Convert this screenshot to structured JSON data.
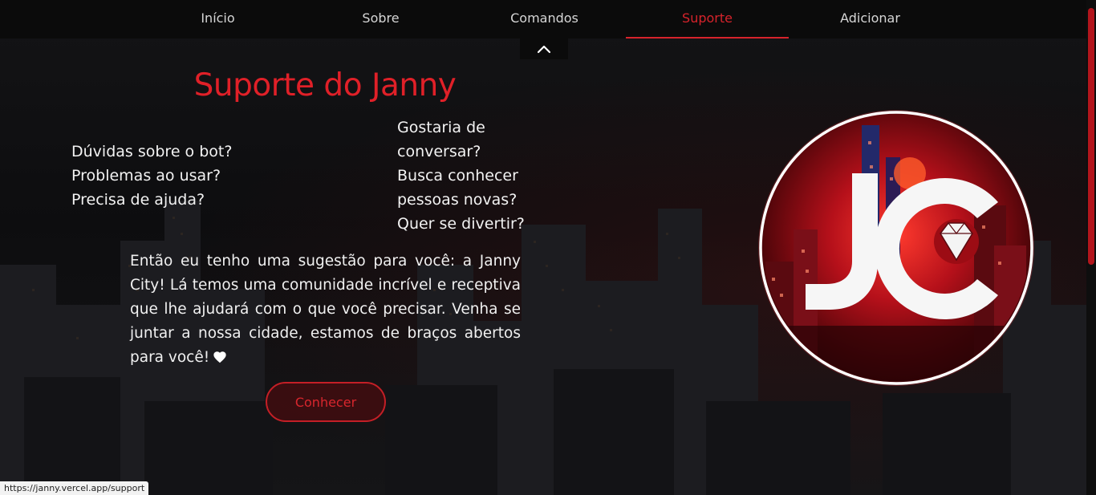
{
  "nav": {
    "items": [
      {
        "label": "Início",
        "active": false
      },
      {
        "label": "Sobre",
        "active": false
      },
      {
        "label": "Comandos",
        "active": false
      },
      {
        "label": "Suporte",
        "active": true
      },
      {
        "label": "Adicionar",
        "active": false
      }
    ]
  },
  "support": {
    "title": "Suporte do Janny",
    "questions_left": [
      "Dúvidas sobre o bot?",
      "Problemas ao usar?",
      "Precisa de ajuda?"
    ],
    "questions_right": [
      "Gostaria de",
      "conversar?",
      "Busca conhecer",
      "pessoas novas?",
      "Quer se divertir?"
    ],
    "description": "Então eu tenho uma sugestão para você: a Janny City! Lá temos uma comunidade incrível e receptiva que lhe ajudará com o que você precisar. Venha se juntar a nossa cidade, estamos de braços abertos para você!",
    "button_label": "Conhecer",
    "logo_letters": "JC"
  },
  "icons": {
    "collapse": "chevron-up-icon",
    "heart": "heart-icon",
    "logo": "janny-city-logo"
  },
  "colors": {
    "accent": "#d6232b",
    "background": "#0d0d0f",
    "navbar": "#0b0b0b"
  },
  "status_bar": {
    "url": "https://janny.vercel.app/support"
  }
}
